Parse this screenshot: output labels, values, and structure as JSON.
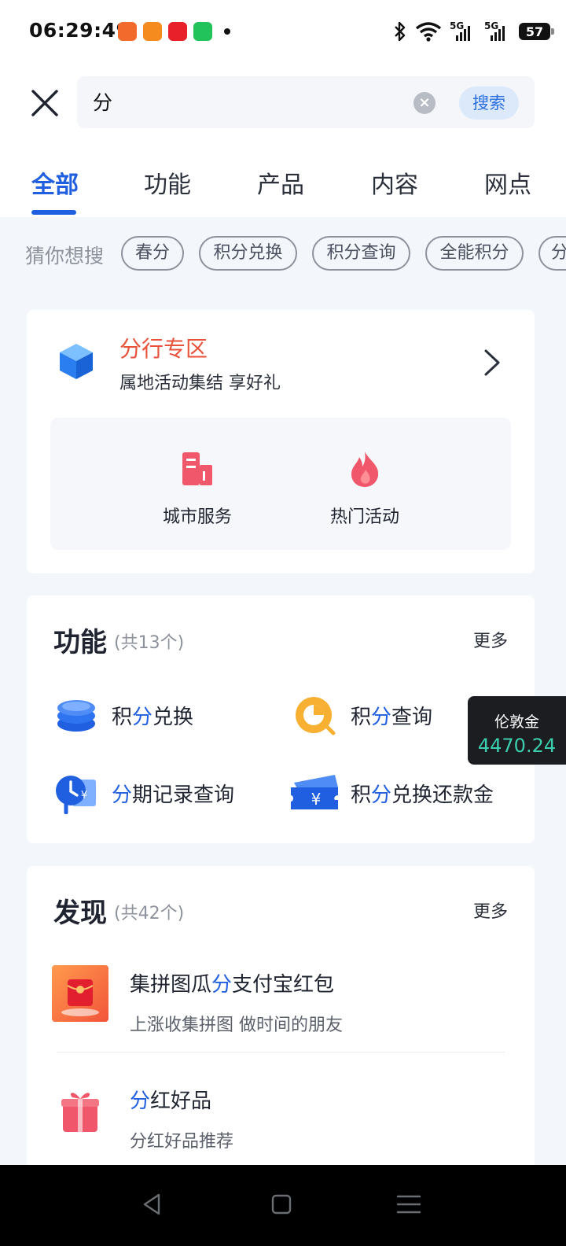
{
  "status_bar": {
    "time": "06:29:49",
    "network1": "5G",
    "network2": "5G",
    "battery": "57"
  },
  "search": {
    "query": "分",
    "button_label": "搜索"
  },
  "tabs": [
    {
      "label": "全部",
      "active": true
    },
    {
      "label": "功能",
      "active": false
    },
    {
      "label": "产品",
      "active": false
    },
    {
      "label": "内容",
      "active": false
    },
    {
      "label": "网点",
      "active": false
    }
  ],
  "guess": {
    "label": "猜你想搜",
    "chips": [
      "春分",
      "积分兑换",
      "积分查询",
      "全能积分",
      "分"
    ]
  },
  "branch": {
    "title": "分行专区",
    "subtitle": "属地活动集结 享好礼",
    "items": [
      {
        "label": "城市服务",
        "icon": "building-icon"
      },
      {
        "label": "热门活动",
        "icon": "flame-icon"
      }
    ]
  },
  "functions": {
    "title": "功能",
    "count": "(共13个)",
    "more": "更多",
    "items": [
      {
        "pre": "积",
        "hl": "分",
        "post": "兑换",
        "icon": "coin-stack-icon"
      },
      {
        "pre": "积",
        "hl": "分",
        "post": "查询",
        "icon": "points-query-icon"
      },
      {
        "pre": "",
        "hl": "分",
        "post": "期记录查询",
        "icon": "installment-record-icon"
      },
      {
        "pre": "积",
        "hl": "分",
        "post": "兑换还款金",
        "icon": "ticket-yuan-icon"
      }
    ]
  },
  "floating": {
    "label": "伦敦金",
    "value": "4470.24"
  },
  "discover": {
    "title": "发现",
    "count": "(共42个)",
    "more": "更多",
    "items": [
      {
        "title_pre": "集拼图瓜",
        "title_hl": "分",
        "title_post": "支付宝红包",
        "subtitle": "上涨收集拼图 做时间的朋友",
        "icon": "red-envelope-icon"
      },
      {
        "title_pre": "",
        "title_hl": "分",
        "title_post": "红好品",
        "subtitle": "分红好品推荐",
        "icon": "gift-icon"
      }
    ]
  },
  "colors": {
    "accent": "#1f5fe0",
    "branch_title": "#e8523a",
    "gold_value": "#3ccfae"
  }
}
